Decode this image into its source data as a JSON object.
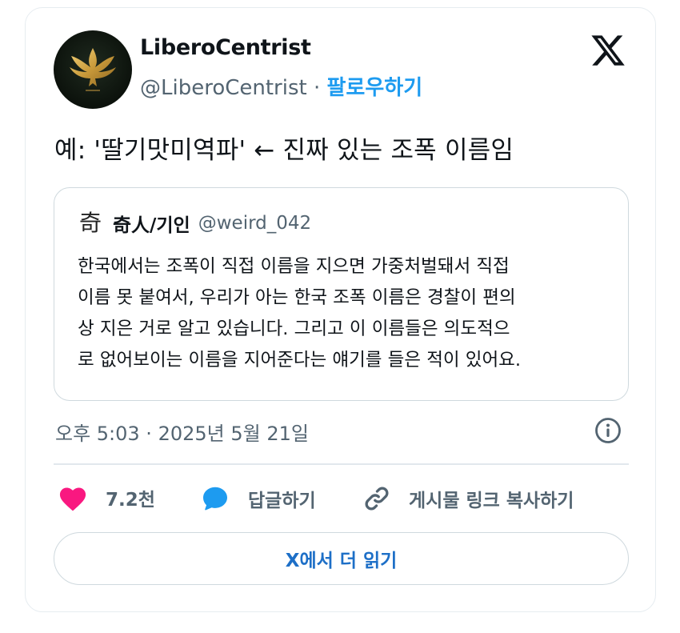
{
  "author": {
    "display_name": "LiberoCentrist",
    "handle": "@LiberoCentrist",
    "separator": "·",
    "follow_label": "팔로우하기"
  },
  "tweet": {
    "text": "예: '딸기맛미역파' ← 진짜 있는 조폭 이름임"
  },
  "quote": {
    "avatar_glyph": "奇",
    "name": "奇人/기인",
    "handle": "@weird_042",
    "lines": [
      "한국에서는 조폭이 직접 이름을 지으면 가중처벌돼서 직접",
      "이름 못 붙여서, 우리가 아는 한국 조폭 이름은 경찰이 편의",
      "상 지은 거로 알고 있습니다. 그리고 이 이름들은 의도적으",
      "로 없어보이는 이름을 지어준다는 얘기를 들은 적이 있어요."
    ]
  },
  "meta": {
    "timestamp": "오후 5:03 · 2025년 5월 21일"
  },
  "actions": {
    "likes": "7.2천",
    "reply": "답글하기",
    "copy_link": "게시물 링크 복사하기"
  },
  "read_more": "X에서 더 읽기",
  "colors": {
    "accent": "#1d9bf0",
    "like": "#f91880",
    "muted": "#536471",
    "text": "#0f1419"
  },
  "icons": {
    "avatar": "golden-phoenix-logo",
    "brand": "x-logo-icon",
    "info": "info-icon",
    "like": "heart-icon",
    "reply": "speech-bubble-icon",
    "copy": "link-icon"
  }
}
